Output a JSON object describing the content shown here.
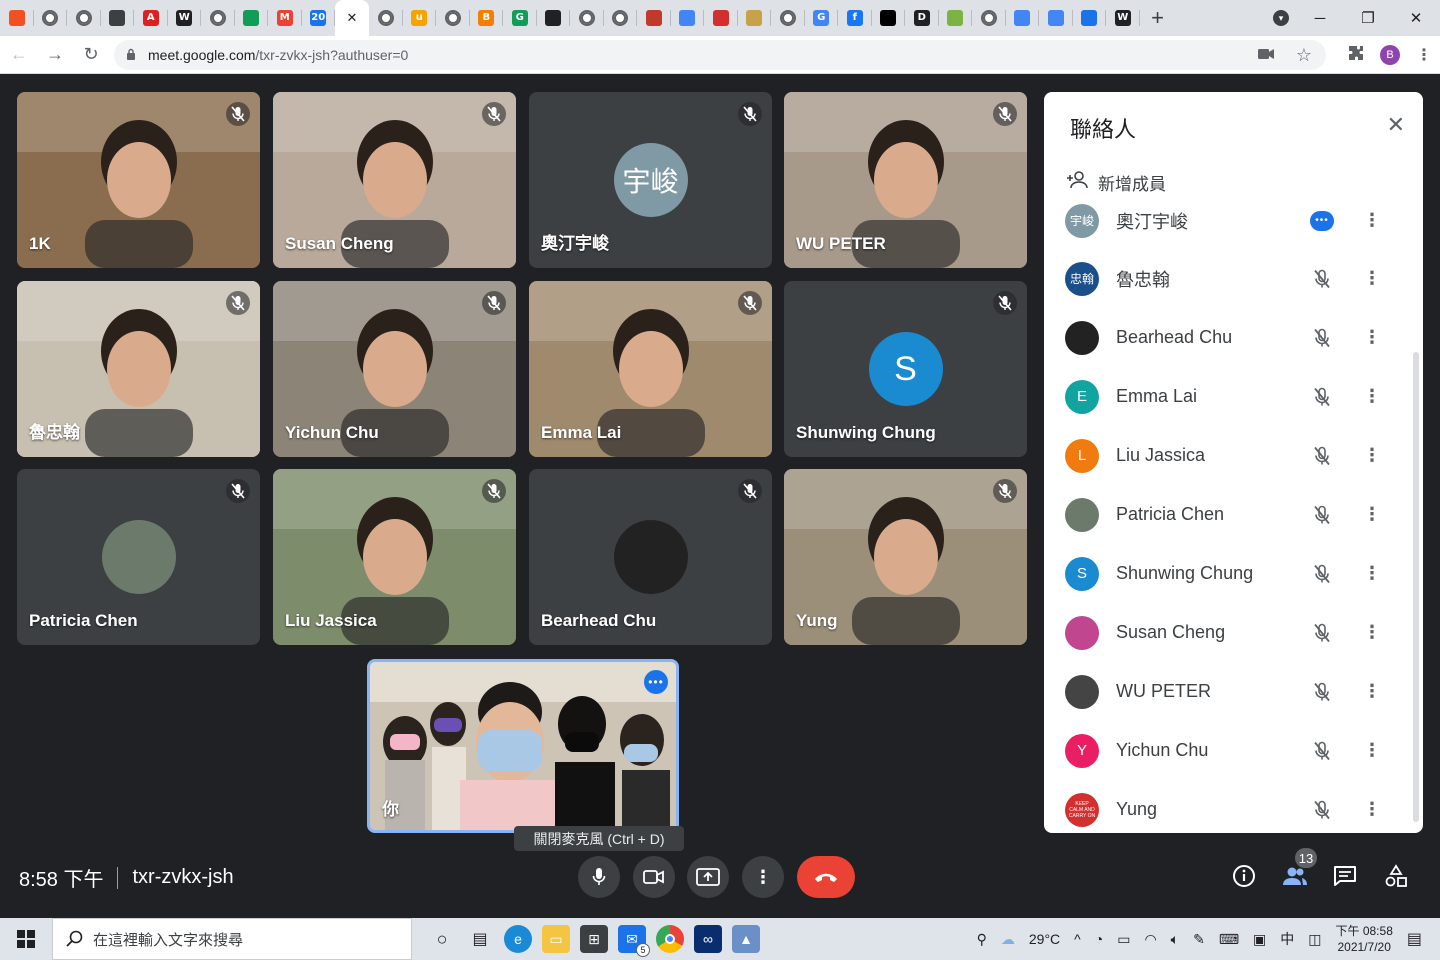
{
  "browser": {
    "tabs": [
      {
        "icon": "windows-icon",
        "color": "#f25022"
      },
      {
        "icon": "globe-icon",
        "color": "#5f6368"
      },
      {
        "icon": "globe-icon",
        "color": "#5f6368"
      },
      {
        "icon": "home-icon",
        "color": "#3c4043"
      },
      {
        "icon": "acrobat-icon",
        "color": "#e02020",
        "glyph": "A"
      },
      {
        "icon": "wikipedia-icon",
        "color": "#202124",
        "glyph": "W"
      },
      {
        "icon": "globe-icon",
        "color": "#5f6368"
      },
      {
        "icon": "bing-icon",
        "color": "#0f9d58"
      },
      {
        "icon": "gmail-icon",
        "color": "#ea4335",
        "glyph": "M"
      },
      {
        "icon": "calendar-icon",
        "color": "#1a73e8",
        "glyph": "20"
      },
      {
        "icon": "close-icon",
        "active": true
      },
      {
        "icon": "globe-icon",
        "color": "#5f6368"
      },
      {
        "icon": "u-icon",
        "color": "#f4a300",
        "glyph": "u"
      },
      {
        "icon": "globe-icon",
        "color": "#5f6368"
      },
      {
        "icon": "blogger-icon",
        "color": "#f57d00",
        "glyph": "B"
      },
      {
        "icon": "g-green-icon",
        "color": "#0f9d58",
        "glyph": "G"
      },
      {
        "icon": "eye-icon",
        "color": "#202124"
      },
      {
        "icon": "globe-icon",
        "color": "#5f6368"
      },
      {
        "icon": "globe-icon",
        "color": "#5f6368"
      },
      {
        "icon": "swirl-icon",
        "color": "#c0392b"
      },
      {
        "icon": "cube-icon",
        "color": "#4285f4"
      },
      {
        "icon": "stamp-icon",
        "color": "#d32f2f"
      },
      {
        "icon": "figure-icon",
        "color": "#c8a24a"
      },
      {
        "icon": "globe-icon",
        "color": "#5f6368"
      },
      {
        "icon": "google-icon",
        "color": "#4285f4",
        "glyph": "G"
      },
      {
        "icon": "facebook-icon",
        "color": "#1877f2",
        "glyph": "f"
      },
      {
        "icon": "medium-icon",
        "color": "#000000"
      },
      {
        "icon": "d-icon",
        "color": "#202124",
        "glyph": "D"
      },
      {
        "icon": "globe-green-icon",
        "color": "#7cb342"
      },
      {
        "icon": "globe-icon",
        "color": "#5f6368"
      },
      {
        "icon": "cube-icon",
        "color": "#4285f4"
      },
      {
        "icon": "cube-icon",
        "color": "#4285f4"
      },
      {
        "icon": "chart-icon",
        "color": "#1a73e8"
      },
      {
        "icon": "wikipedia-icon",
        "color": "#202124",
        "glyph": "W"
      }
    ],
    "new_tab_label": "+",
    "url_host": "meet.google.com",
    "url_path": "/txr-zvkx-jsh?authuser=0",
    "profile_initial": "B"
  },
  "meet": {
    "tiles": [
      {
        "name": "1K",
        "bg": "#8a6d4f",
        "type": "video"
      },
      {
        "name": "Susan Cheng",
        "bg": "#b8a99a",
        "type": "video"
      },
      {
        "name": "奧汀宇峻",
        "bg": "#3c4043",
        "type": "avatar",
        "avatar_text": "宇峻",
        "avatar_color": "#7f9aa5"
      },
      {
        "name": "WU PETER",
        "bg": "#a89a8a",
        "type": "video"
      },
      {
        "name": "魯忠翰",
        "bg": "#c7bfb0",
        "type": "video"
      },
      {
        "name": "Yichun Chu",
        "bg": "#8d8478",
        "type": "video"
      },
      {
        "name": "Emma Lai",
        "bg": "#a08a6e",
        "type": "video"
      },
      {
        "name": "Shunwing Chung",
        "bg": "#3c4043",
        "type": "avatar",
        "avatar_text": "S",
        "avatar_color": "#1a8ad1"
      },
      {
        "name": "Patricia Chen",
        "bg": "#3c4043",
        "type": "photo",
        "avatar_color": "#6b7a6a"
      },
      {
        "name": "Liu Jassica",
        "bg": "#7d8c6a",
        "type": "video"
      },
      {
        "name": "Bearhead Chu",
        "bg": "#3c4043",
        "type": "photo",
        "avatar_color": "#222222"
      },
      {
        "name": "Yung",
        "bg": "#9b8f7a",
        "type": "video"
      }
    ],
    "self_name": "你",
    "tooltip": "關閉麥克風 (Ctrl + D)",
    "time": "8:58 下午",
    "meeting_code": "txr-zvkx-jsh",
    "participant_count": "13"
  },
  "panel": {
    "title": "聯絡人",
    "add_people": "新增成員",
    "people": [
      {
        "name": "奧汀宇峻",
        "avatar_text": "宇峻",
        "avatar_color": "#7f9aa5",
        "speaking": true
      },
      {
        "name": "魯忠翰",
        "avatar_text": "忠翰",
        "avatar_color": "#1a4f8a"
      },
      {
        "name": "Bearhead Chu",
        "avatar_text": "",
        "avatar_color": "#222222"
      },
      {
        "name": "Emma Lai",
        "avatar_text": "E",
        "avatar_color": "#12a4a0"
      },
      {
        "name": "Liu Jassica",
        "avatar_text": "L",
        "avatar_color": "#f07b0e"
      },
      {
        "name": "Patricia Chen",
        "avatar_text": "",
        "avatar_color": "#6b7a6a"
      },
      {
        "name": "Shunwing Chung",
        "avatar_text": "S",
        "avatar_color": "#1a8ad1"
      },
      {
        "name": "Susan Cheng",
        "avatar_text": "",
        "avatar_color": "#c0478f"
      },
      {
        "name": "WU PETER",
        "avatar_text": "",
        "avatar_color": "#444444"
      },
      {
        "name": "Yichun Chu",
        "avatar_text": "Y",
        "avatar_color": "#e91e63"
      },
      {
        "name": "Yung",
        "avatar_text": "KEEP CALM AND CARRY ON",
        "avatar_color": "#d32f2f"
      }
    ]
  },
  "taskbar": {
    "search_placeholder": "在這裡輸入文字來搜尋",
    "weather": "29°C",
    "ime": "中",
    "clock_time": "下午 08:58",
    "clock_date": "2021/7/20",
    "mail_badge": "5"
  }
}
